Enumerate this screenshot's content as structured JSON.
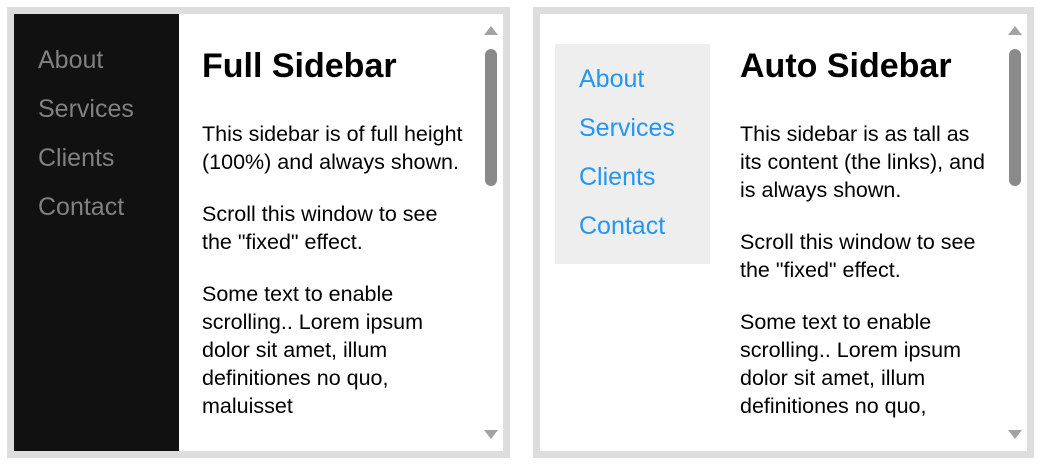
{
  "left_frame": {
    "nav": [
      "About",
      "Services",
      "Clients",
      "Contact"
    ],
    "title": "Full Sidebar",
    "paragraphs": [
      "This sidebar is of full height (100%) and always shown.",
      "Scroll this window to see the \"fixed\" effect.",
      "Some text to enable scrolling.. Lorem ipsum dolor sit amet, illum definitiones no quo, maluisset"
    ]
  },
  "right_frame": {
    "nav": [
      "About",
      "Services",
      "Clients",
      "Contact"
    ],
    "title": "Auto Sidebar",
    "paragraphs": [
      "This sidebar is as tall as its content (the links), and is always shown.",
      "Scroll this window to see the \"fixed\" effect.",
      "Some text to enable scrolling.. Lorem ipsum dolor sit amet, illum definitiones no quo,"
    ]
  },
  "colors": {
    "full_sidebar_bg": "#111111",
    "full_sidebar_link": "#818181",
    "auto_sidebar_bg": "#eeeeee",
    "auto_sidebar_link": "#2196f3",
    "frame_border": "#dddddd"
  },
  "icons": {
    "scroll_up": "scroll-up-arrow-icon",
    "scroll_down": "scroll-down-arrow-icon"
  }
}
